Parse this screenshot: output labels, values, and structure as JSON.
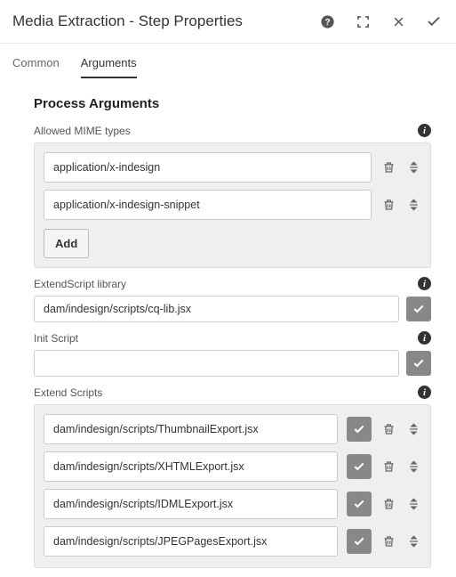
{
  "header": {
    "title": "Media Extraction - Step Properties"
  },
  "tabs": {
    "common": "Common",
    "arguments": "Arguments"
  },
  "section": {
    "title": "Process Arguments"
  },
  "mime": {
    "label": "Allowed MIME types",
    "items": [
      "application/x-indesign",
      "application/x-indesign-snippet"
    ],
    "add_label": "Add"
  },
  "extendscript_library": {
    "label": "ExtendScript library",
    "value": "dam/indesign/scripts/cq-lib.jsx"
  },
  "init_script": {
    "label": "Init Script",
    "value": ""
  },
  "extend_scripts": {
    "label": "Extend Scripts",
    "items": [
      "dam/indesign/scripts/ThumbnailExport.jsx",
      "dam/indesign/scripts/XHTMLExport.jsx",
      "dam/indesign/scripts/IDMLExport.jsx",
      "dam/indesign/scripts/JPEGPagesExport.jsx"
    ]
  }
}
